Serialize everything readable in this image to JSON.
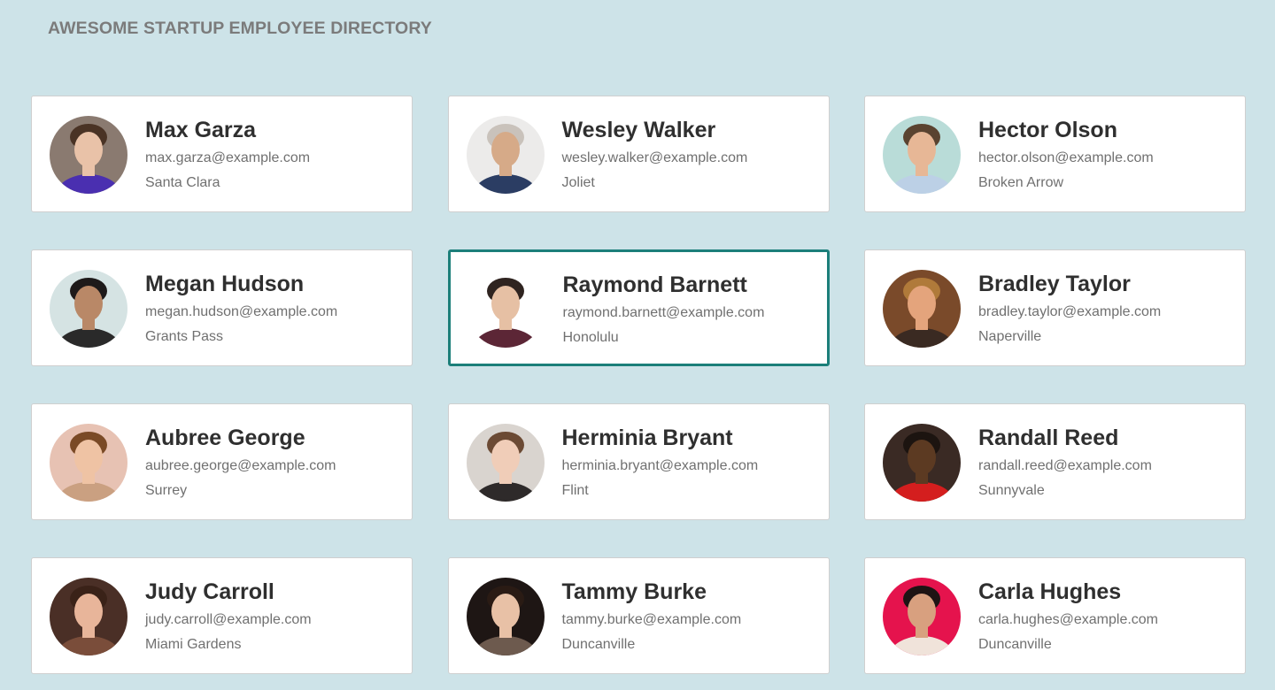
{
  "header": {
    "title": "AWESOME STARTUP EMPLOYEE DIRECTORY"
  },
  "employees": [
    {
      "name": "Max Garza",
      "email": "max.garza@example.com",
      "city": "Santa Clara",
      "selected": false,
      "colors": {
        "bg": "#8a7a70",
        "skin": "#e9c2a8",
        "hair": "#4a3325",
        "shirt": "#4a2fb0"
      }
    },
    {
      "name": "Wesley Walker",
      "email": "wesley.walker@example.com",
      "city": "Joliet",
      "selected": false,
      "colors": {
        "bg": "#ecebea",
        "skin": "#d6aa88",
        "hair": "#c9c2bb",
        "shirt": "#2b3d63"
      }
    },
    {
      "name": "Hector Olson",
      "email": "hector.olson@example.com",
      "city": "Broken Arrow",
      "selected": false,
      "colors": {
        "bg": "#b9dcd8",
        "skin": "#e7b796",
        "hair": "#5a4330",
        "shirt": "#bcd0e6"
      }
    },
    {
      "name": "Megan Hudson",
      "email": "megan.hudson@example.com",
      "city": "Grants Pass",
      "selected": false,
      "colors": {
        "bg": "#d5e3e3",
        "skin": "#b98867",
        "hair": "#1e1a1a",
        "shirt": "#2a2a2a"
      }
    },
    {
      "name": "Raymond Barnett",
      "email": "raymond.barnett@example.com",
      "city": "Honolulu",
      "selected": true,
      "colors": {
        "bg": "#ffffff",
        "skin": "#e6c0a4",
        "hair": "#2f2420",
        "shirt": "#5c2636"
      }
    },
    {
      "name": "Bradley Taylor",
      "email": "bradley.taylor@example.com",
      "city": "Naperville",
      "selected": false,
      "colors": {
        "bg": "#7a4a2a",
        "skin": "#e4a47c",
        "hair": "#b07a3a",
        "shirt": "#3a2a22"
      }
    },
    {
      "name": "Aubree George",
      "email": "aubree.george@example.com",
      "city": "Surrey",
      "selected": false,
      "colors": {
        "bg": "#e7c2b3",
        "skin": "#efc3a4",
        "hair": "#7a4a26",
        "shirt": "#caa081"
      }
    },
    {
      "name": "Herminia Bryant",
      "email": "herminia.bryant@example.com",
      "city": "Flint",
      "selected": false,
      "colors": {
        "bg": "#d9d4cf",
        "skin": "#f0cdb8",
        "hair": "#6b4a34",
        "shirt": "#2e2a2a"
      }
    },
    {
      "name": "Randall Reed",
      "email": "randall.reed@example.com",
      "city": "Sunnyvale",
      "selected": false,
      "colors": {
        "bg": "#3a2a24",
        "skin": "#5c3a22",
        "hair": "#1c1410",
        "shirt": "#d41e1e"
      }
    },
    {
      "name": "Judy Carroll",
      "email": "judy.carroll@example.com",
      "city": "Miami Gardens",
      "selected": false,
      "colors": {
        "bg": "#4a2f26",
        "skin": "#e8b59a",
        "hair": "#3a2218",
        "shirt": "#7a4d3a"
      }
    },
    {
      "name": "Tammy Burke",
      "email": "tammy.burke@example.com",
      "city": "Duncanville",
      "selected": false,
      "colors": {
        "bg": "#1e1614",
        "skin": "#e8c1a6",
        "hair": "#2a1b14",
        "shirt": "#6d5a4e"
      }
    },
    {
      "name": "Carla Hughes",
      "email": "carla.hughes@example.com",
      "city": "Duncanville",
      "selected": false,
      "colors": {
        "bg": "#e5134d",
        "skin": "#d8a07f",
        "hair": "#1e1414",
        "shirt": "#f0e3da"
      }
    }
  ]
}
